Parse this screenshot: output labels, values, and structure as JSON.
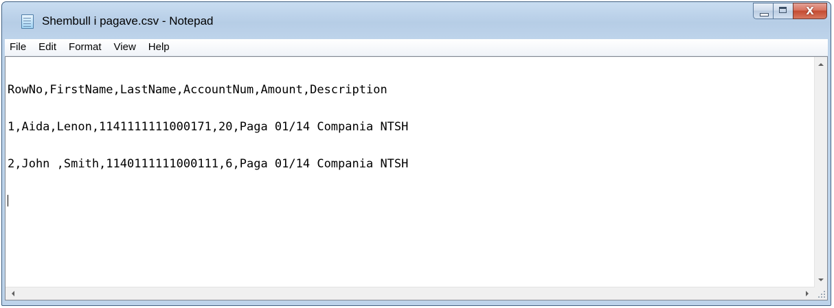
{
  "window": {
    "title": "Shembull i pagave.csv - Notepad",
    "app_icon": "notepad-icon"
  },
  "caption_buttons": {
    "minimize_icon": "minimize-icon",
    "maximize_icon": "maximize-icon",
    "close_icon": "close-icon",
    "close_glyph": "X",
    "close_color": "#c44b31"
  },
  "menu": {
    "items": [
      {
        "label": "File"
      },
      {
        "label": "Edit"
      },
      {
        "label": "Format"
      },
      {
        "label": "View"
      },
      {
        "label": "Help"
      }
    ]
  },
  "document": {
    "lines": [
      "RowNo,FirstName,LastName,AccountNum,Amount,Description",
      "1,Aida,Lenon,1141111111000171,20,Paga 01/14 Compania NTSH",
      "2,John ,Smith,1140111111000111,6,Paga 01/14 Compania NTSH",
      ""
    ]
  }
}
